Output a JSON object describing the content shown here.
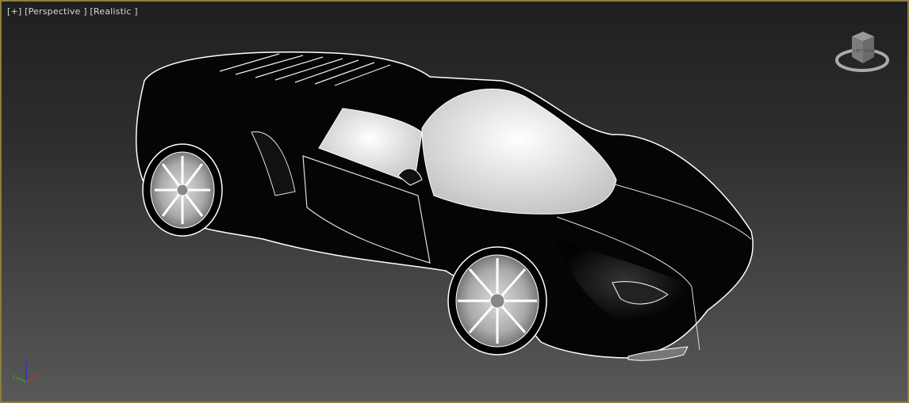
{
  "viewport": {
    "label_plus": "[+]",
    "label_view": "[Perspective ]",
    "label_shading": "[Realistic ]",
    "border_color": "#8c7d3c"
  },
  "viewcube": {
    "face_left": "LEFT",
    "face_front": "FRONT"
  },
  "axis_tripod": {
    "x": "x",
    "y": "y",
    "z": "z",
    "colors": {
      "x": "#c83232",
      "y": "#32a032",
      "z": "#3232c8"
    }
  }
}
